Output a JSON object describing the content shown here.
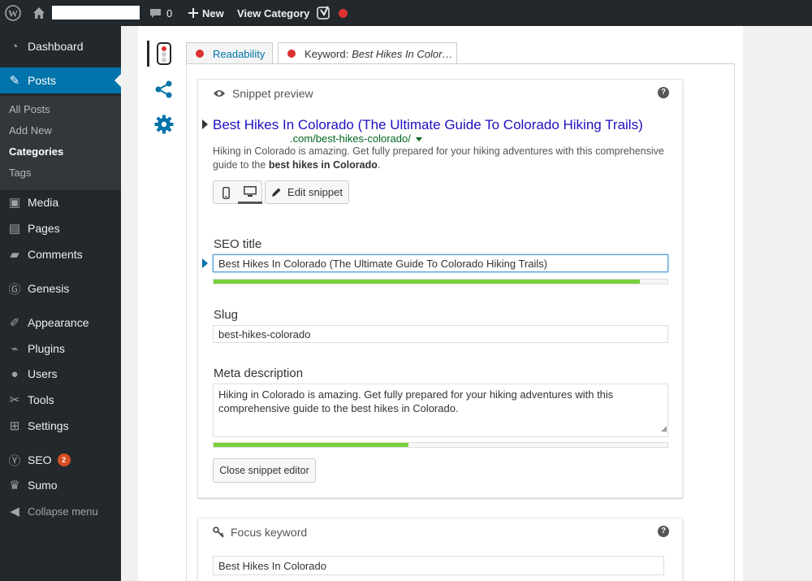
{
  "admin_bar": {
    "comments_count": "0",
    "new_label": "New",
    "view_category_label": "View Category"
  },
  "sidebar": {
    "items": [
      {
        "label": "Dashboard",
        "icon": "dashboard-icon"
      },
      {
        "label": "Posts",
        "icon": "pin-icon"
      },
      {
        "label": "Media",
        "icon": "media-icon"
      },
      {
        "label": "Pages",
        "icon": "pages-icon"
      },
      {
        "label": "Comments",
        "icon": "comment-icon"
      },
      {
        "label": "Genesis",
        "icon": "genesis-icon"
      },
      {
        "label": "Appearance",
        "icon": "brush-icon"
      },
      {
        "label": "Plugins",
        "icon": "plugin-icon"
      },
      {
        "label": "Users",
        "icon": "users-icon"
      },
      {
        "label": "Tools",
        "icon": "wrench-icon"
      },
      {
        "label": "Settings",
        "icon": "settings-icon"
      },
      {
        "label": "SEO",
        "icon": "yoast-icon",
        "badge": "2"
      },
      {
        "label": "Sumo",
        "icon": "crown-icon"
      },
      {
        "label": "Collapse menu",
        "icon": "collapse-icon"
      }
    ],
    "submenu": [
      "All Posts",
      "Add New",
      "Categories",
      "Tags"
    ]
  },
  "tabs": {
    "readability": "Readability",
    "keyword_prefix": "Keyword:",
    "keyword_value": "Best Hikes In Color…"
  },
  "snippet": {
    "header": "Snippet preview",
    "title": "Best Hikes In Colorado (The Ultimate Guide To Colorado Hiking Trails)",
    "url": ".com/best-hikes-colorado/",
    "description_start": "Hiking in Colorado is amazing. Get fully prepared for your hiking adventures with this comprehensive guide to the ",
    "description_bold": "best hikes in Colorado",
    "description_end": ".",
    "edit_label": "Edit snippet"
  },
  "form": {
    "seo_title_label": "SEO title",
    "seo_title_value": "Best Hikes In Colorado (The Ultimate Guide To Colorado Hiking Trails)",
    "seo_title_progress": 0.94,
    "slug_label": "Slug",
    "slug_value": "best-hikes-colorado",
    "meta_label": "Meta description",
    "meta_value": "Hiking in Colorado is amazing. Get fully prepared for your hiking adventures with this comprehensive guide to the best hikes in Colorado.",
    "meta_progress": 0.43,
    "close_label": "Close snippet editor"
  },
  "focus": {
    "header": "Focus keyword",
    "value": "Best Hikes In Colorado"
  },
  "colors": {
    "accent": "#0073aa",
    "good": "#7ad03a",
    "bad": "#dc3232",
    "link": "#1e0fbe",
    "url": "#006621"
  }
}
